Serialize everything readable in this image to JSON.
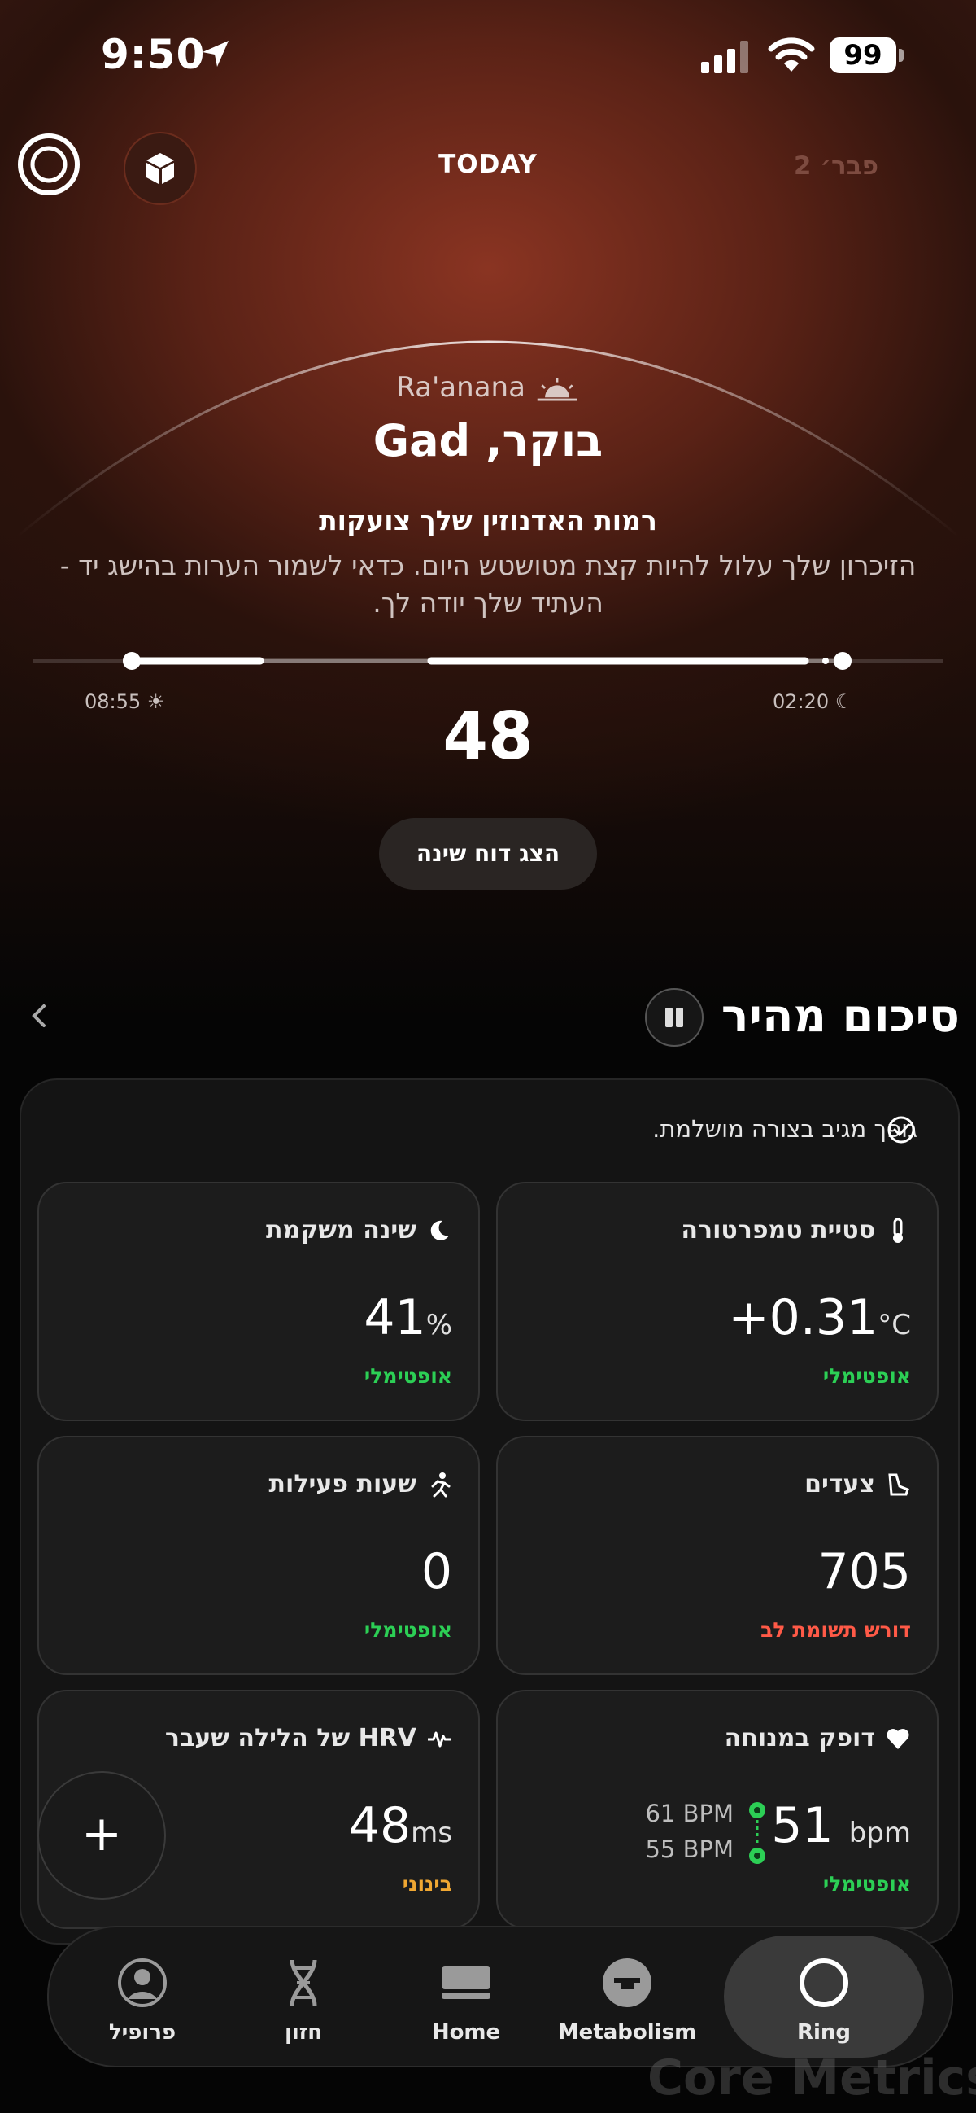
{
  "status_bar": {
    "time": "9:50",
    "battery": "99"
  },
  "header": {
    "title": "TODAY",
    "next_date": "2 פבר׳"
  },
  "hero": {
    "city": "Ra'anana",
    "greeting": "בוקר, Gad",
    "message_title": "רמות האדנוזין שלך צועקות",
    "message_body": "הזיכרון שלך עלול להיות קצת מטושטש היום. כדאי לשמור הערות בהישג יד - העתיד שלך יודה לך.",
    "wake_time": "08:55",
    "sleep_time": "02:20",
    "score": "48",
    "sleep_report_button": "הצג דוח שינה"
  },
  "summary": {
    "title": "סיכום מהיר",
    "note": "גופך מגיב בצורה מושלמת.",
    "tiles": {
      "temperature": {
        "label": "סטיית טמפרטורה",
        "value": "+0.31",
        "unit": "°C",
        "status": "אופטימלי"
      },
      "deep_sleep": {
        "label": "שינה משקמת",
        "value": "41",
        "unit": "%",
        "status": "אופטימלי"
      },
      "steps": {
        "label": "צעדים",
        "value": "705",
        "status": "דורש תשומת לב"
      },
      "activity": {
        "label": "שעות פעילות",
        "value": "0",
        "status": "אופטימלי"
      },
      "resting_hr": {
        "label": "דופק במנוחה",
        "value": "51",
        "unit": "bpm",
        "high": "61 BPM",
        "low": "55 BPM",
        "status": "אופטימלי"
      },
      "hrv": {
        "label": "HRV של הלילה שעבר",
        "value": "48",
        "unit": "ms",
        "status": "בינוני"
      }
    }
  },
  "fab": {
    "label": "+"
  },
  "tabbar": {
    "profile": "פרופיל",
    "vision": "חזון",
    "home": "Home",
    "metabolism": "Metabolism",
    "ring": "Ring"
  },
  "watermark": "Core Metrics",
  "colors": {
    "optimal": "#2ccf55",
    "attention": "#ff5a47",
    "medium": "#f0a732",
    "hero_red": "#8a3422"
  }
}
